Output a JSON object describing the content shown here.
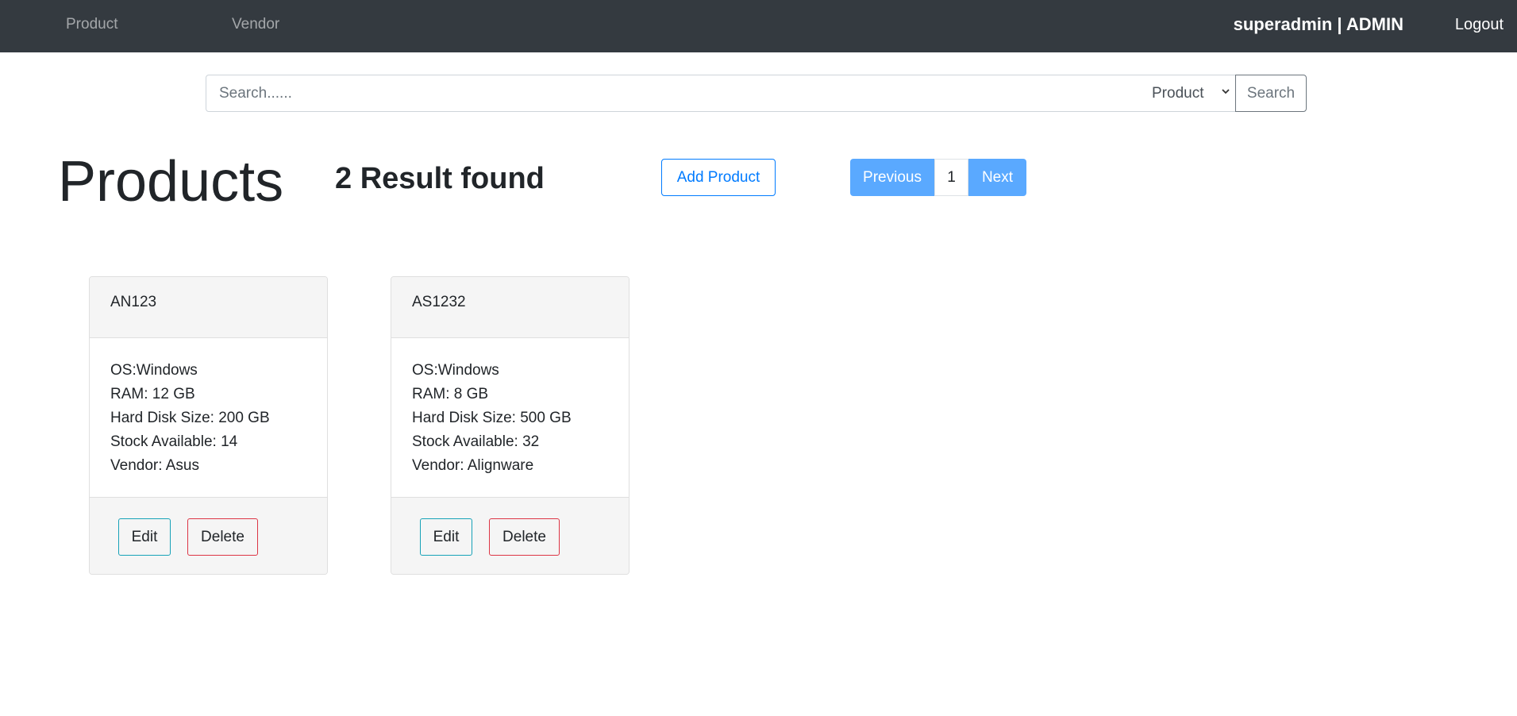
{
  "nav": {
    "links": [
      "Product",
      "Vendor"
    ],
    "user": "superadmin | ADMIN",
    "logout": "Logout"
  },
  "search": {
    "placeholder": "Search......",
    "value": "",
    "select_value": "Product",
    "button": "Search"
  },
  "header": {
    "title": "Products",
    "result_count": "2 Result found",
    "add_button": "Add Product"
  },
  "pagination": {
    "previous": "Previous",
    "current_page": "1",
    "next": "Next"
  },
  "colors": {
    "navbar_bg": "#343a40",
    "primary": "#007bff",
    "pagination_active": "#5aa9ff",
    "edit_border": "#17a2b8",
    "delete_border": "#dc3545"
  },
  "products": [
    {
      "name": "AN123",
      "os": "OS:Windows",
      "ram": "RAM: 12 GB",
      "hdd": "Hard Disk Size: 200 GB",
      "stock": "Stock Available: 14",
      "vendor": "Vendor: Asus",
      "edit": "Edit",
      "delete": "Delete"
    },
    {
      "name": "AS1232",
      "os": "OS:Windows",
      "ram": "RAM: 8 GB",
      "hdd": "Hard Disk Size: 500 GB",
      "stock": "Stock Available: 32",
      "vendor": "Vendor: Alignware",
      "edit": "Edit",
      "delete": "Delete"
    }
  ]
}
